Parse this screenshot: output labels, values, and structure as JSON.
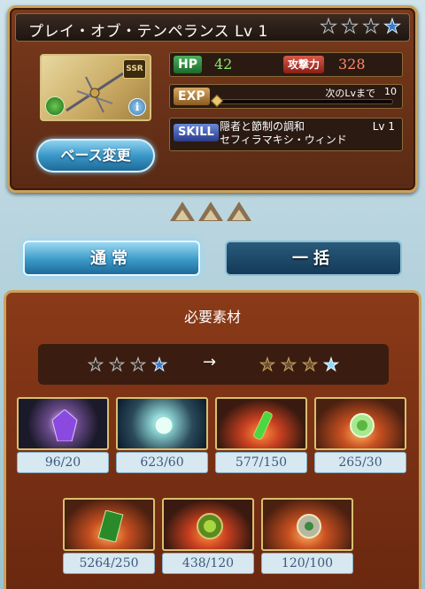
{
  "weapon": {
    "name": "プレイ・オブ・テンペランス Lv 1",
    "rarity_badge": "SSR",
    "info_icon_label": "i",
    "stars_filled": 3,
    "stars_blue": 1
  },
  "stats": {
    "hp_label": "HP",
    "hp_value": "42",
    "atk_label": "攻撃力",
    "atk_value": "328",
    "exp_label": "EXP",
    "next_label": "次のLvまで",
    "next_value": "10",
    "exp_progress": 0,
    "skill_label": "SKILL",
    "skill_name_line1": "隠者と節制の調和",
    "skill_name_line2": "セフィラマキシ・ウィンド",
    "skill_level": "Lv 1"
  },
  "buttons": {
    "base_change": "ベース変更",
    "tab_normal": "通常",
    "tab_bulk": "一括"
  },
  "materials_panel": {
    "title": "必要素材",
    "arrow": "→",
    "items": [
      {
        "name": "purple-crystal",
        "count": "96/20"
      },
      {
        "name": "light-orb",
        "count": "623/60"
      },
      {
        "name": "green-vial",
        "count": "577/150"
      },
      {
        "name": "wind-emblem",
        "count": "265/30"
      },
      {
        "name": "green-card",
        "count": "5264/250"
      },
      {
        "name": "green-gear-orb",
        "count": "438/120"
      },
      {
        "name": "silver-emblem",
        "count": "120/100"
      }
    ]
  },
  "colors": {
    "accent_blue": "#3a9ac8",
    "frame_gold": "#c9a25a",
    "panel_brown": "#8a3a18",
    "count_text": "#3a5a80"
  }
}
